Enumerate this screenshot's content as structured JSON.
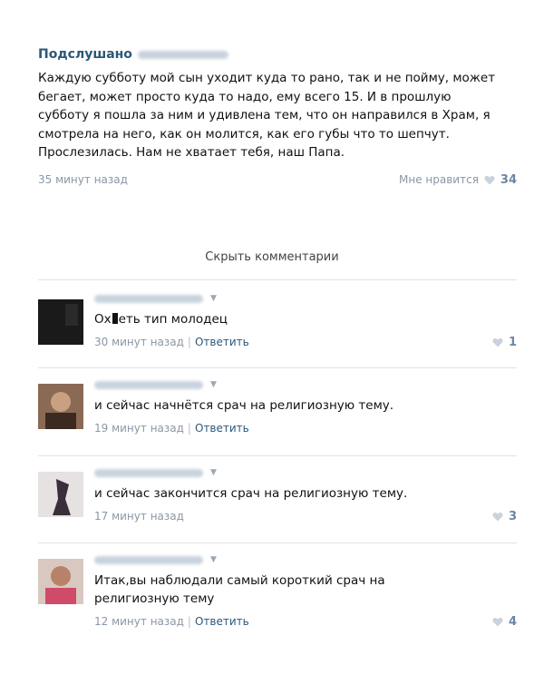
{
  "post": {
    "author": "Подслушано",
    "text": "Каждую субботу мой сын уходит куда то рано, так и не пойму, может бегает, может просто куда то надо, ему всего 15. И в прошлую субботу я пошла за ним и удивлена тем, что он направился в Храм, я смотрела на него, как он молится, как его губы что то шепчут. Прослезилась. Нам не хватает тебя, наш Папа.",
    "time": "35 минут назад",
    "like_label": "Мне нравится",
    "like_count": "34"
  },
  "hide_comments": "Скрыть комментарии",
  "comments": [
    {
      "text_a": "Ох",
      "text_b": "еть тип молодец",
      "time": "30 минут назад",
      "reply": "Ответить",
      "likes": "1"
    },
    {
      "text": "и сейчас начнётся срач на религиозную тему.",
      "time": "19 минут назад",
      "reply": "Ответить",
      "likes": ""
    },
    {
      "text": "и сейчас закончится срач на религиозную тему.",
      "time": "17 минут назад",
      "reply": "",
      "likes": "3"
    },
    {
      "text": "Итак,вы наблюдали самый короткий срач на религиозную тему",
      "time": "12 минут назад",
      "reply": "Ответить",
      "likes": "4"
    }
  ],
  "colors": {
    "link": "#2b587a",
    "muted": "#8a97a6",
    "heart": "#c8d3de"
  }
}
